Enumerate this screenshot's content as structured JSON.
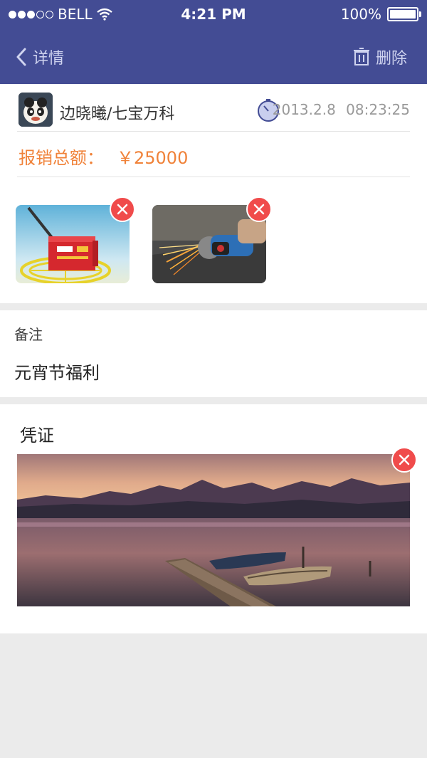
{
  "status_bar": {
    "carrier": "BELL",
    "time": "4:21 PM",
    "battery": "100%"
  },
  "nav": {
    "back_label": "详情",
    "delete_label": "删除"
  },
  "expense": {
    "user": "边晓曦/七宝万科",
    "date": "2013.2.8",
    "time": "08:23:25",
    "total_label": "报销总额：",
    "total_value": "￥25000"
  },
  "remark": {
    "label": "备注",
    "value": "元宵节福利"
  },
  "voucher": {
    "label": "凭证"
  },
  "colors": {
    "nav_bg": "#434c94",
    "accent": "#f08239",
    "remove": "#f04b4b"
  }
}
